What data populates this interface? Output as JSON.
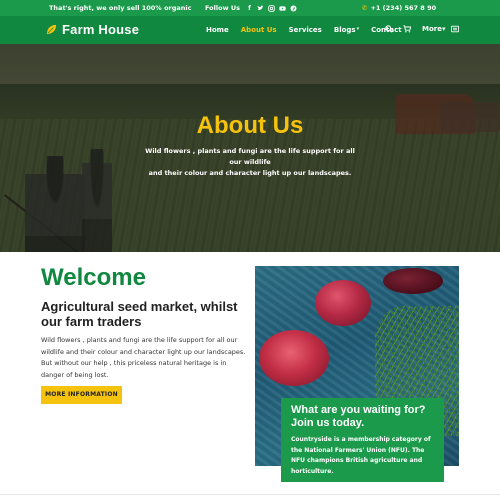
{
  "topbar": {
    "tagline": "That's right, we only sell 100% organic",
    "follow_label": "Follow Us",
    "social_icons": [
      "facebook-icon",
      "twitter-icon",
      "instagram-icon",
      "youtube-icon",
      "pinterest-icon"
    ],
    "phone": "+1 (234) 567 8 90"
  },
  "header": {
    "logo_text": "Farm House",
    "nav": [
      {
        "label": "Home",
        "active": false
      },
      {
        "label": "About Us",
        "active": true
      },
      {
        "label": "Services",
        "active": false
      },
      {
        "label": "Blogs",
        "active": false,
        "dropdown": true
      },
      {
        "label": "Contact",
        "active": false
      },
      {
        "label": "More",
        "active": false,
        "dropdown": true
      }
    ],
    "icons": [
      "search-icon",
      "cart-icon",
      "menu-icon"
    ]
  },
  "hero": {
    "title": "About Us",
    "text_line1": "Wild flowers , plants and fungi are the life support for all our wildlife",
    "text_line2": "and their colour and character light up our landscapes."
  },
  "welcome": {
    "title": "Welcome",
    "subtitle": "Agricultural seed market, whilst our farm traders",
    "body": "Wild flowers , plants and fungi are the life support for all our wildlife and their colour and character light up our landscapes. But without our help , this priceless natural heritage is in danger of being lost.",
    "button_label": "MORE INFORMATION"
  },
  "callout": {
    "title": "What are you waiting for? Join us today.",
    "text": "Countryside is a membership category of the National Farmers' Union (NFU). The NFU champions British agriculture and horticulture."
  },
  "colors": {
    "brand_green": "#11883f",
    "topbar_green": "#1a9a4a",
    "accent_yellow": "#f5c20e"
  }
}
